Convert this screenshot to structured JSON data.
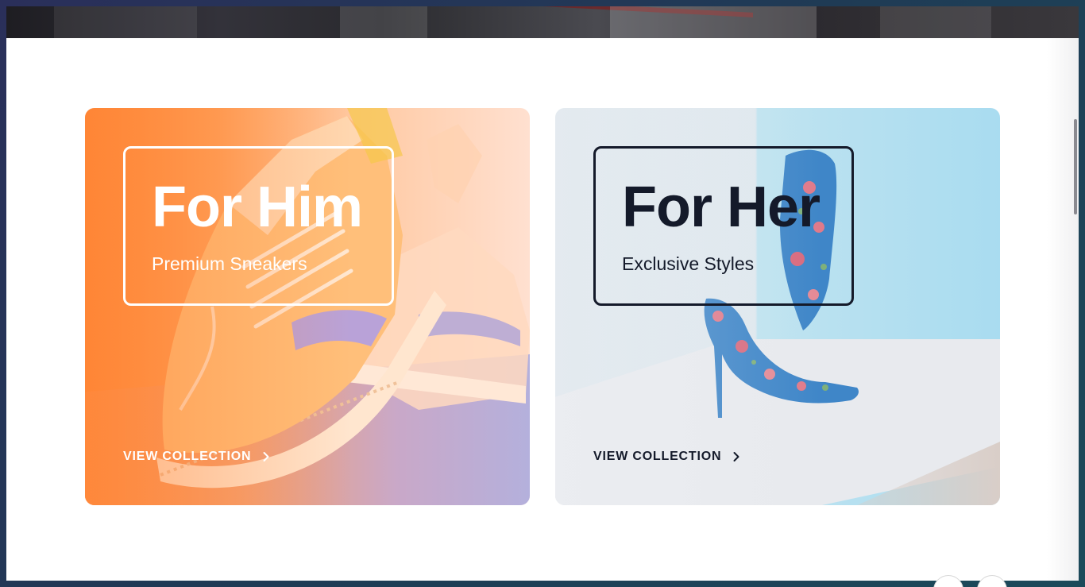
{
  "cards": {
    "him": {
      "title": "For Him",
      "subtitle": "Premium Sneakers",
      "cta_label": "VIEW COLLECTION",
      "cta_icon": "chevron-right-icon",
      "accent": "#ff8a3a"
    },
    "her": {
      "title": "For Her",
      "subtitle": "Exclusive Styles",
      "cta_label": "VIEW COLLECTION",
      "cta_icon": "chevron-right-icon",
      "accent": "#a9dcf0"
    }
  },
  "colors": {
    "page_background": "#ffffff",
    "dark_text": "#141a2a",
    "light_text": "#ffffff"
  }
}
